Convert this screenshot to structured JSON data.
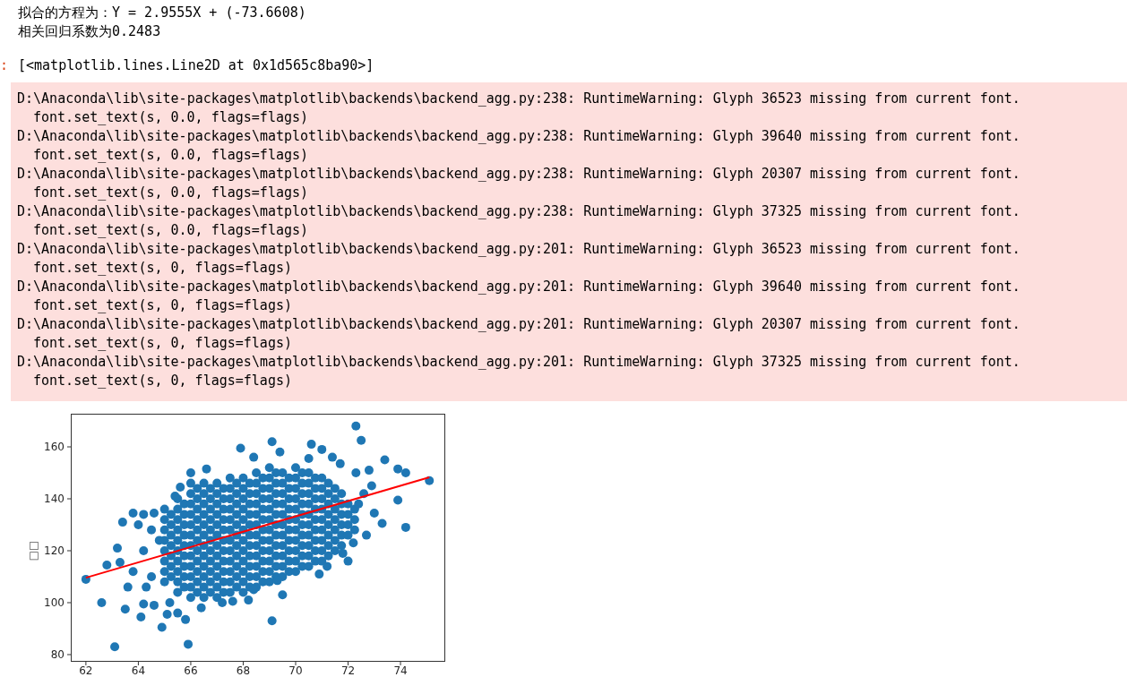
{
  "output_lines": [
    "拟合的方程为：Y = 2.9555X + (-73.6608)",
    "相关回归系数为0.2483"
  ],
  "out_prompt": ":",
  "result_repr": "[<matplotlib.lines.Line2D at 0x1d565c8ba90>]",
  "warnings": [
    {
      "path_line": "D:\\Anaconda\\lib\\site-packages\\matplotlib\\backends\\backend_agg.py:238: RuntimeWarning: Glyph 36523 missing from current font.",
      "code_line": "font.set_text(s, 0.0, flags=flags)"
    },
    {
      "path_line": "D:\\Anaconda\\lib\\site-packages\\matplotlib\\backends\\backend_agg.py:238: RuntimeWarning: Glyph 39640 missing from current font.",
      "code_line": "font.set_text(s, 0.0, flags=flags)"
    },
    {
      "path_line": "D:\\Anaconda\\lib\\site-packages\\matplotlib\\backends\\backend_agg.py:238: RuntimeWarning: Glyph 20307 missing from current font.",
      "code_line": "font.set_text(s, 0.0, flags=flags)"
    },
    {
      "path_line": "D:\\Anaconda\\lib\\site-packages\\matplotlib\\backends\\backend_agg.py:238: RuntimeWarning: Glyph 37325 missing from current font.",
      "code_line": "font.set_text(s, 0.0, flags=flags)"
    },
    {
      "path_line": "D:\\Anaconda\\lib\\site-packages\\matplotlib\\backends\\backend_agg.py:201: RuntimeWarning: Glyph 36523 missing from current font.",
      "code_line": "font.set_text(s, 0, flags=flags)"
    },
    {
      "path_line": "D:\\Anaconda\\lib\\site-packages\\matplotlib\\backends\\backend_agg.py:201: RuntimeWarning: Glyph 39640 missing from current font.",
      "code_line": "font.set_text(s, 0, flags=flags)"
    },
    {
      "path_line": "D:\\Anaconda\\lib\\site-packages\\matplotlib\\backends\\backend_agg.py:201: RuntimeWarning: Glyph 20307 missing from current font.",
      "code_line": "font.set_text(s, 0, flags=flags)"
    },
    {
      "path_line": "D:\\Anaconda\\lib\\site-packages\\matplotlib\\backends\\backend_agg.py:201: RuntimeWarning: Glyph 37325 missing from current font.",
      "code_line": "font.set_text(s, 0, flags=flags)"
    }
  ],
  "figure": {
    "chart_data": {
      "type": "scatter",
      "ylabel": "□□",
      "xlim": [
        61.44,
        75.69
      ],
      "ylim": [
        77.41,
        172.59
      ],
      "xticks": [
        62,
        64,
        66,
        68,
        70,
        72,
        74
      ],
      "yticks": [
        80,
        100,
        120,
        140,
        160
      ],
      "series": [
        {
          "color": "#1f77b4",
          "x": [
            65,
            65,
            65,
            65,
            65,
            65,
            65,
            65,
            65.25,
            65.25,
            65.25,
            65.25,
            65.25,
            65.25,
            65.25,
            65.5,
            65.5,
            65.5,
            65.5,
            65.5,
            65.5,
            65.5,
            65.5,
            65.5,
            65.5,
            65.75,
            65.75,
            65.75,
            65.75,
            65.75,
            65.75,
            65.75,
            65.75,
            65.75,
            66,
            66,
            66,
            66,
            66,
            66,
            66,
            66,
            66,
            66,
            66,
            66,
            66.25,
            66.25,
            66.25,
            66.25,
            66.25,
            66.25,
            66.25,
            66.25,
            66.25,
            66.25,
            66.25,
            66.5,
            66.5,
            66.5,
            66.5,
            66.5,
            66.5,
            66.5,
            66.5,
            66.5,
            66.5,
            66.5,
            66.5,
            66.75,
            66.75,
            66.75,
            66.75,
            66.75,
            66.75,
            66.75,
            66.75,
            66.75,
            66.75,
            66.75,
            67,
            67,
            67,
            67,
            67,
            67,
            67,
            67,
            67,
            67,
            67,
            67,
            67.25,
            67.25,
            67.25,
            67.25,
            67.25,
            67.25,
            67.25,
            67.25,
            67.25,
            67.25,
            67.25,
            67.5,
            67.5,
            67.5,
            67.5,
            67.5,
            67.5,
            67.5,
            67.5,
            67.5,
            67.5,
            67.5,
            67.5,
            67.75,
            67.75,
            67.75,
            67.75,
            67.75,
            67.75,
            67.75,
            67.75,
            67.75,
            67.75,
            67.75,
            68,
            68,
            68,
            68,
            68,
            68,
            68,
            68,
            68,
            68,
            68,
            68,
            68.25,
            68.25,
            68.25,
            68.25,
            68.25,
            68.25,
            68.25,
            68.25,
            68.25,
            68.25,
            68.25,
            68.5,
            68.5,
            68.5,
            68.5,
            68.5,
            68.5,
            68.5,
            68.5,
            68.5,
            68.5,
            68.5,
            68.5,
            68.75,
            68.75,
            68.75,
            68.75,
            68.75,
            68.75,
            68.75,
            68.75,
            68.75,
            68.75,
            68.75,
            69,
            69,
            69,
            69,
            69,
            69,
            69,
            69,
            69,
            69,
            69,
            69,
            69.25,
            69.25,
            69.25,
            69.25,
            69.25,
            69.25,
            69.25,
            69.25,
            69.25,
            69.25,
            69.25,
            69.5,
            69.5,
            69.5,
            69.5,
            69.5,
            69.5,
            69.5,
            69.5,
            69.5,
            69.5,
            69.5,
            69.75,
            69.75,
            69.75,
            69.75,
            69.75,
            69.75,
            69.75,
            69.75,
            69.75,
            69.75,
            70,
            70,
            70,
            70,
            70,
            70,
            70,
            70,
            70,
            70,
            70,
            70.25,
            70.25,
            70.25,
            70.25,
            70.25,
            70.25,
            70.25,
            70.25,
            70.25,
            70.25,
            70.5,
            70.5,
            70.5,
            70.5,
            70.5,
            70.5,
            70.5,
            70.5,
            70.5,
            70.5,
            70.75,
            70.75,
            70.75,
            70.75,
            70.75,
            70.75,
            70.75,
            70.75,
            70.75,
            71,
            71,
            71,
            71,
            71,
            71,
            71,
            71,
            71,
            71.25,
            71.25,
            71.25,
            71.25,
            71.25,
            71.25,
            71.25,
            71.25,
            71.5,
            71.5,
            71.5,
            71.5,
            71.5,
            71.5,
            71.5,
            71.75,
            71.75,
            71.75,
            71.75,
            71.75,
            71.75,
            72,
            72,
            72,
            72,
            72.25,
            72.25,
            72.25,
            72.3,
            72.5,
            69.1,
            67.9,
            70.6,
            71,
            73.4,
            74.2,
            73.9,
            75.1,
            74.2,
            73.9,
            73.3,
            62,
            62.6,
            62.8,
            63.1,
            63.5,
            64.1,
            64.9,
            65.1,
            65.9,
            65.5,
            65.8,
            66.4,
            69.1,
            69.5,
            67.2,
            64.2,
            64.6,
            63.2,
            63.4,
            63.8,
            64.2,
            64.6,
            65.4,
            65.6,
            66,
            66.6,
            68.4,
            69.4,
            70.5,
            71.4,
            71.7,
            72.8,
            72.6,
            72.7,
            72,
            70.9,
            69.3,
            68.4,
            67.6,
            68.2,
            63.6,
            63.3,
            64.5,
            64,
            72.2,
            71.8,
            72.3,
            72.9,
            73,
            64.5,
            64.2,
            63.8,
            64.8,
            64.3,
            65.2,
            71.2,
            72.4
          ],
          "values": [
            108,
            112,
            116,
            120,
            124,
            128,
            132,
            136,
            110,
            114,
            118,
            122,
            126,
            130,
            134,
            104,
            108,
            112,
            116,
            120,
            124,
            128,
            132,
            136,
            140,
            106,
            110,
            114,
            118,
            122,
            126,
            130,
            134,
            138,
            102,
            106,
            110,
            114,
            118,
            122,
            126,
            130,
            134,
            138,
            142,
            146,
            104,
            108,
            112,
            116,
            120,
            124,
            128,
            132,
            136,
            140,
            144,
            102,
            106,
            110,
            114,
            118,
            122,
            126,
            130,
            134,
            138,
            142,
            146,
            104,
            108,
            112,
            116,
            120,
            124,
            128,
            132,
            136,
            140,
            144,
            102,
            106,
            110,
            114,
            118,
            122,
            126,
            130,
            134,
            138,
            142,
            146,
            104,
            108,
            112,
            116,
            120,
            124,
            128,
            132,
            136,
            140,
            144,
            104,
            108,
            112,
            116,
            120,
            124,
            128,
            132,
            136,
            140,
            144,
            148,
            106,
            110,
            114,
            118,
            122,
            126,
            130,
            134,
            138,
            142,
            146,
            104,
            108,
            112,
            116,
            120,
            124,
            128,
            132,
            136,
            140,
            144,
            148,
            106,
            110,
            114,
            118,
            122,
            126,
            130,
            134,
            138,
            142,
            146,
            106,
            110,
            114,
            118,
            122,
            126,
            130,
            134,
            138,
            142,
            146,
            150,
            108,
            112,
            116,
            120,
            124,
            128,
            132,
            136,
            140,
            144,
            148,
            108,
            112,
            116,
            120,
            124,
            128,
            132,
            136,
            140,
            144,
            148,
            152,
            110,
            114,
            118,
            122,
            126,
            130,
            134,
            138,
            142,
            146,
            150,
            110,
            114,
            118,
            122,
            126,
            130,
            134,
            138,
            142,
            146,
            150,
            112,
            116,
            120,
            124,
            128,
            132,
            136,
            140,
            144,
            148,
            112,
            116,
            120,
            124,
            128,
            132,
            136,
            140,
            144,
            148,
            152,
            114,
            118,
            122,
            126,
            130,
            134,
            138,
            142,
            146,
            150,
            114,
            118,
            122,
            126,
            130,
            134,
            138,
            142,
            146,
            150,
            116,
            120,
            124,
            128,
            132,
            136,
            140,
            144,
            148,
            116,
            120,
            124,
            128,
            132,
            136,
            140,
            144,
            148,
            118,
            122,
            126,
            130,
            134,
            138,
            142,
            146,
            120,
            124,
            128,
            132,
            136,
            140,
            144,
            122,
            126,
            130,
            134,
            138,
            142,
            126,
            130,
            134,
            138,
            128,
            132,
            136,
            168,
            162.5,
            162,
            159.5,
            161,
            159,
            155,
            150,
            151.5,
            147,
            129,
            139.5,
            130.5,
            109,
            100,
            114.5,
            83,
            97.5,
            94.5,
            90.5,
            95.5,
            84,
            96,
            93.5,
            98,
            93,
            103,
            100,
            99.5,
            99,
            121,
            131,
            134.5,
            134,
            134.5,
            141,
            144.5,
            150,
            151.5,
            156,
            158,
            155.5,
            156,
            153.5,
            151,
            142,
            126,
            116,
            111,
            108.5,
            105,
            100.5,
            101,
            106,
            115.5,
            128,
            130,
            123,
            119,
            150,
            145,
            134.5,
            110,
            120,
            112,
            124,
            106,
            100,
            114,
            138
          ]
        },
        {
          "type": "line",
          "color": "#ff0000",
          "x": [
            62,
            75.1
          ],
          "values": [
            109.6,
            148.3
          ]
        }
      ]
    }
  }
}
